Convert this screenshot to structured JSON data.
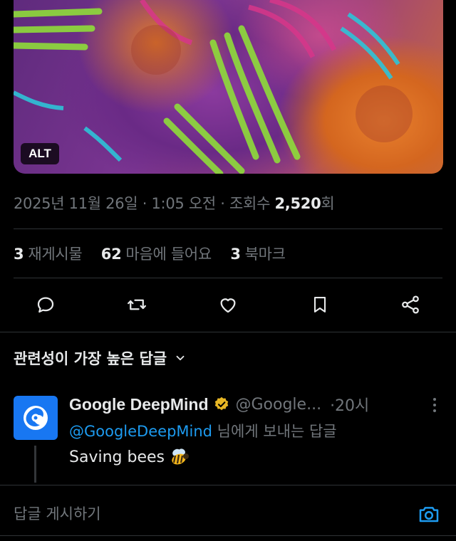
{
  "media": {
    "alt_badge": "ALT"
  },
  "tweet_meta": {
    "date": "2025년 11월 26일",
    "sep1": "·",
    "time": "1:05 오전",
    "sep2": "·",
    "views_prefix": "조회수",
    "views_count": "2,520",
    "views_suffix": "회"
  },
  "stats": [
    {
      "count": "3",
      "label": "재게시물"
    },
    {
      "count": "62",
      "label": "마음에 들어요"
    },
    {
      "count": "3",
      "label": "북마크"
    }
  ],
  "actions": {
    "reply": "reply-icon",
    "repost": "repost-icon",
    "like": "heart-icon",
    "bookmark": "bookmark-icon",
    "share": "share-icon"
  },
  "sort": {
    "label": "관련성이 가장 높은 답글"
  },
  "reply": {
    "name": "Google DeepMind",
    "handle": "@Google...",
    "time": "·20시",
    "replying_mention": "@GoogleDeepMind",
    "replying_suffix": " 님에게 보내는 답글",
    "text": "Saving bees"
  },
  "compose": {
    "placeholder": "답글 게시하기"
  },
  "colors": {
    "accent": "#1d9bf0",
    "verified": "#e8b724",
    "muted": "#71767b",
    "avatar_bg": "#1877f2"
  }
}
